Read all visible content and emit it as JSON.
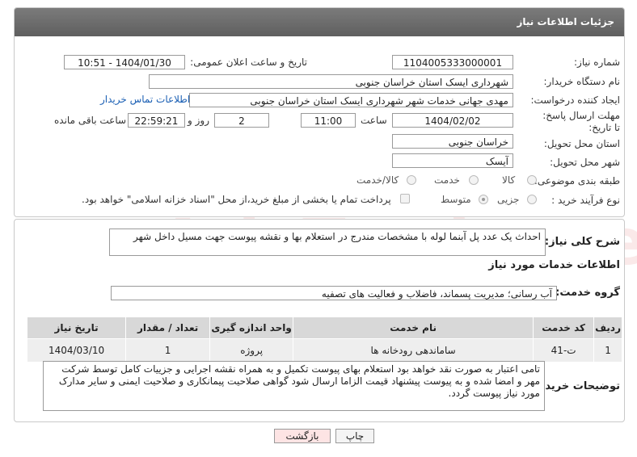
{
  "header": {
    "title": "جزئیات اطلاعات نیاز"
  },
  "fields": {
    "need_number_label": "شماره نیاز:",
    "need_number": "1104005333000001",
    "announce_label": "تاریخ و ساعت اعلان عمومی:",
    "announce_value": "1404/01/30 - 10:51",
    "buyer_org_label": "نام دستگاه خریدار:",
    "buyer_org": "شهرداری ایسک استان خراسان جنوبی",
    "creator_label": "ایجاد کننده درخواست:",
    "creator": "مهدی جهانی خدمات شهر شهرداری ایسک استان خراسان جنوبی",
    "contact_link": "اطلاعات تماس خریدار",
    "deadline_label": "مهلت ارسال پاسخ: تا تاریخ:",
    "deadline_date": "1404/02/02",
    "hour_label": "ساعت",
    "deadline_time": "11:00",
    "days_value": "2",
    "days_label": "روز و",
    "remaining_time": "22:59:21",
    "remaining_label": "ساعت باقی مانده",
    "province_label": "استان محل تحویل:",
    "province": "خراسان جنوبی",
    "city_label": "شهر محل تحویل:",
    "city": "آیسک",
    "category_label": "طبقه بندی موضوعی:",
    "category_options": [
      "کالا",
      "خدمت",
      "کالا/خدمت"
    ],
    "process_label": "نوع فرآیند خرید :",
    "process_options": [
      "جزیی",
      "متوسط"
    ],
    "payment_note": "پرداخت تمام یا بخشی از مبلغ خرید،از محل \"اسناد خزانه اسلامی\" خواهد بود."
  },
  "description": {
    "label": "شرح کلی نیاز:",
    "text": "احداث یک عدد پل آبنما لوله با مشخصات مندرج در استعلام بها و نقشه پیوست جهت مسیل داخل شهر"
  },
  "services": {
    "section_title": "اطلاعات خدمات مورد نیاز",
    "group_label": "گروه خدمت:",
    "group_value": "آب رسانی؛ مدیریت پسماند، فاضلاب و فعالیت های تصفیه",
    "columns": [
      "ردیف",
      "کد خدمت",
      "نام خدمت",
      "واحد اندازه گیری",
      "تعداد / مقدار",
      "تاریخ نیاز"
    ],
    "rows": [
      {
        "index": "1",
        "code": "ت-41",
        "name": "ساماندهی رودخانه ها",
        "unit": "پروژه",
        "qty": "1",
        "date": "1404/03/10"
      }
    ]
  },
  "buyer_notes": {
    "label": "توضیحات خریدار:",
    "text": "تامی اعتبار به صورت نقد خواهد بود استعلام بهای پیوست تکمیل و به همراه نقشه اجرایی و جزییات کامل توسط شرکت مهر و امضا شده و به پیوست پیشنهاد قیمت الزاما ارسال شود گواهی صلاحیت پیمانکاری و صلاحیت ایمنی و سایر مدارک مورد نیاز پیوست گردد."
  },
  "buttons": {
    "print": "چاپ",
    "back": "بازگشت"
  },
  "watermark": "AriaTender.neT",
  "colors": {
    "header_bg": "#6b6b6b",
    "link": "#1a5fb4",
    "back_button_bg": "#fde4e4"
  }
}
